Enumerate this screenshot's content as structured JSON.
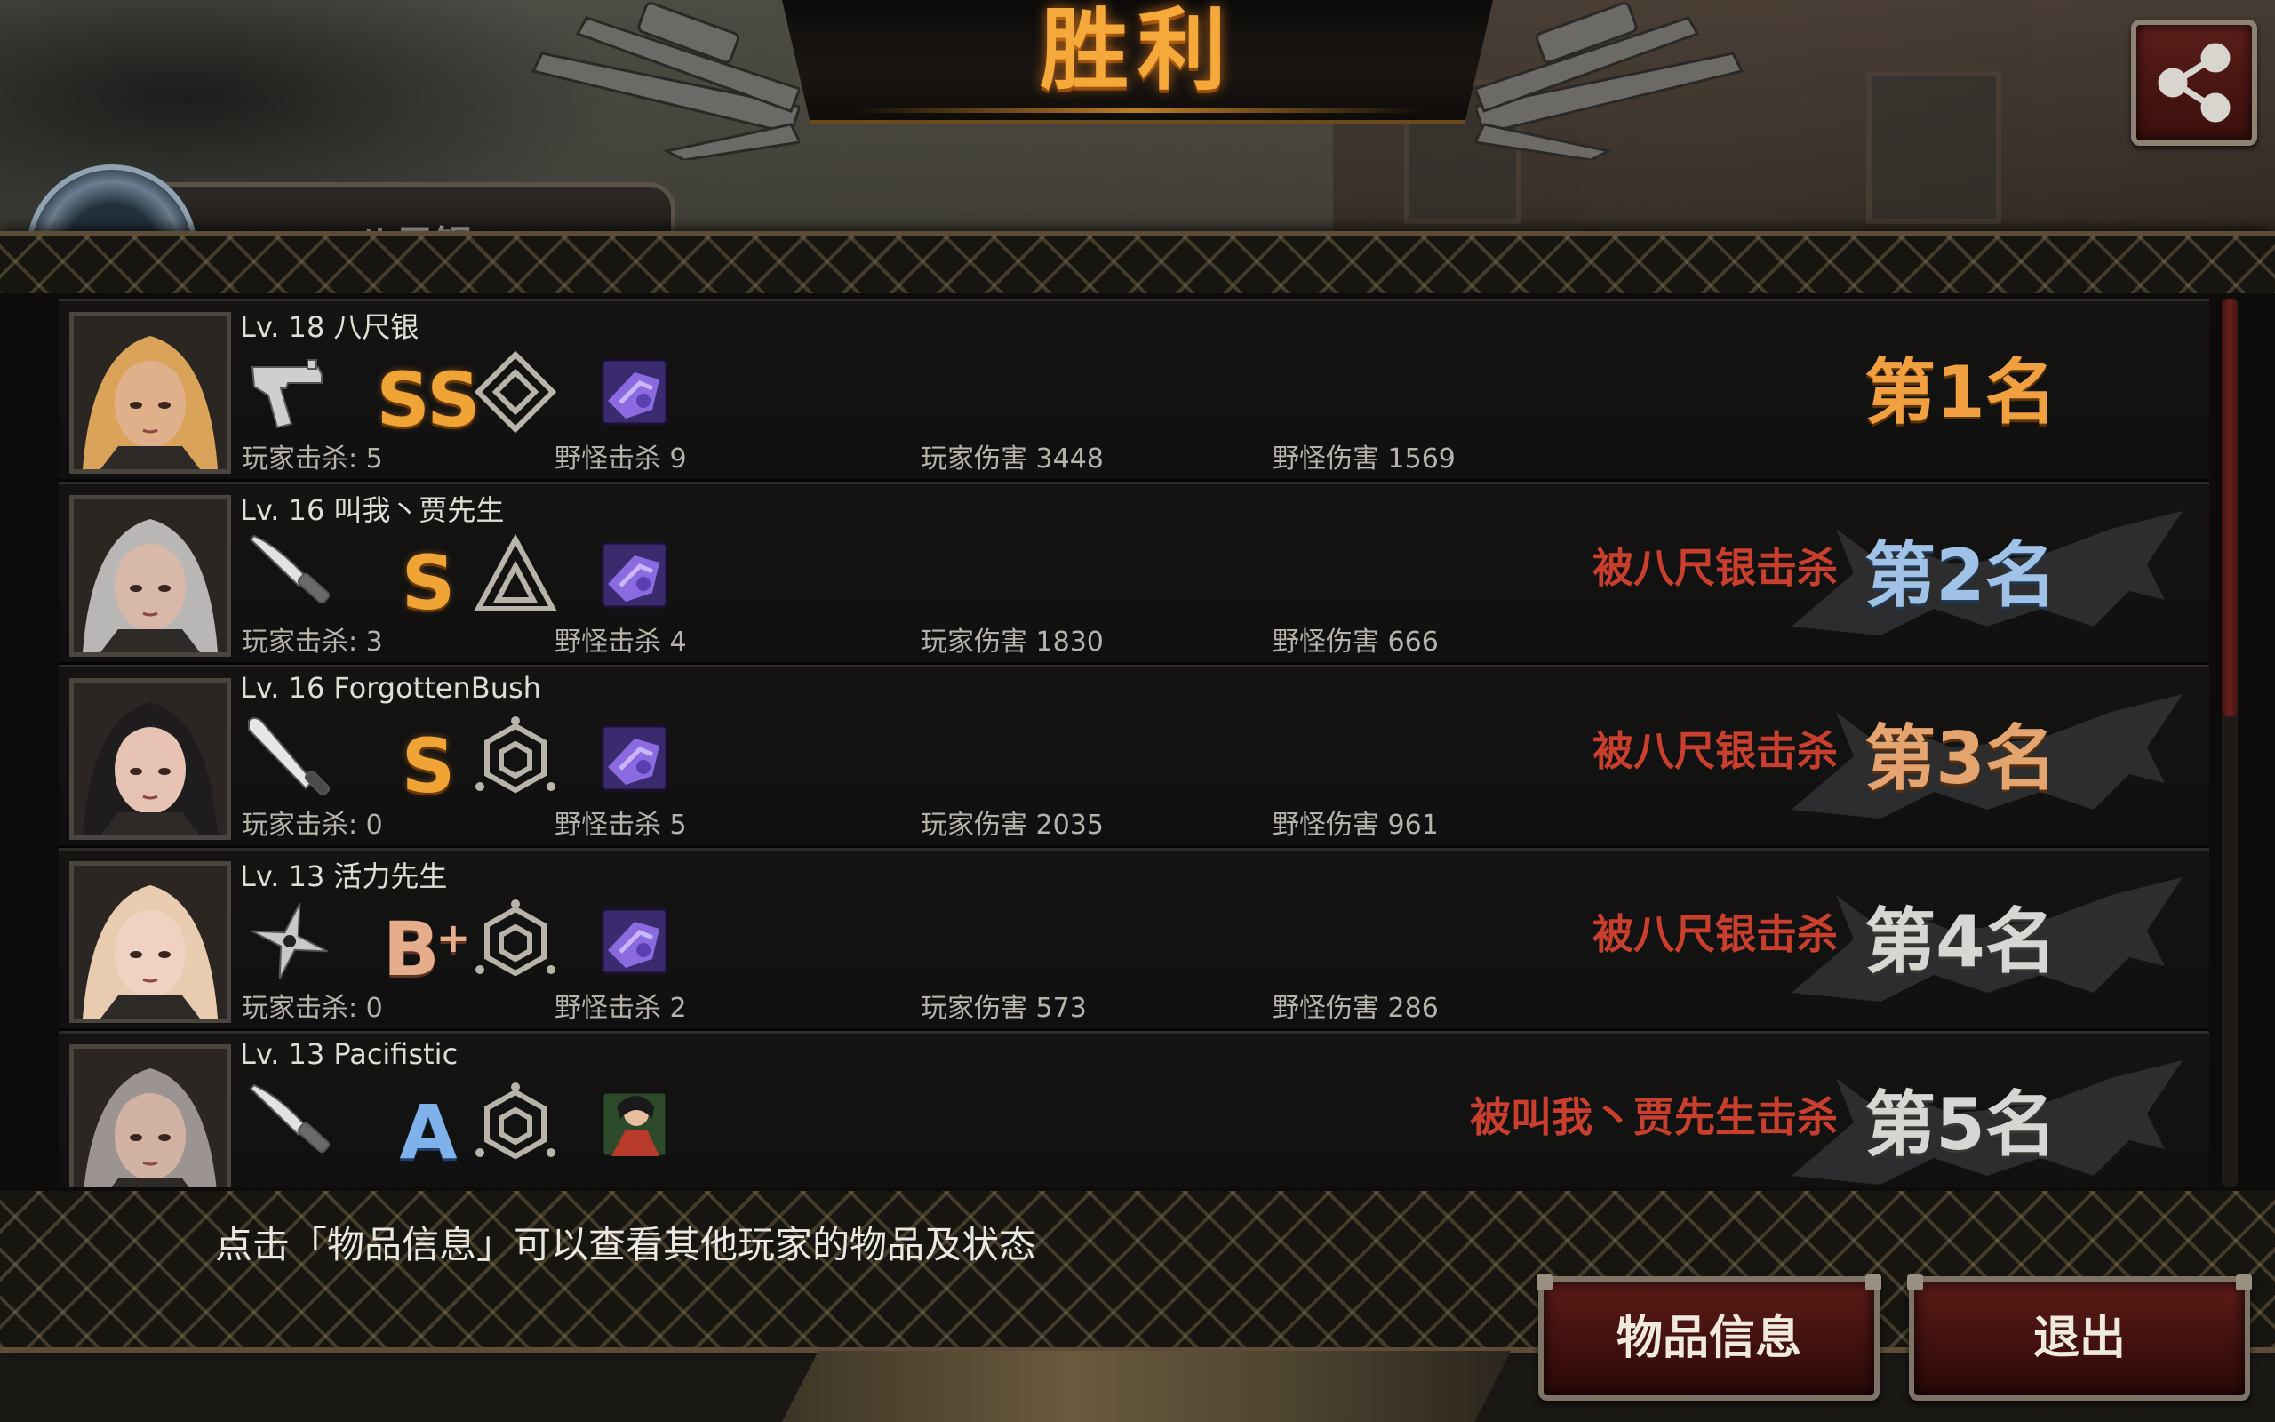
{
  "title": "胜利",
  "share_icon": "share-icon",
  "player_tag": {
    "name": "八尺银"
  },
  "players": [
    {
      "level": "Lv. 18",
      "name": "八尺银",
      "weapon_icon": "pistol-icon",
      "grade": "SS",
      "grade_sup": "",
      "rank_icon": "diamond-emblem-icon",
      "item_icon": "purple-gear-icon",
      "player_kills": "玩家击杀: 5",
      "monster_kills": "野怪击杀 9",
      "player_damage": "玩家伤害 3448",
      "monster_damage": "野怪伤害 1569",
      "killed_by": "",
      "rank": "第1名",
      "portrait_hair": "#d9a45a",
      "portrait_skin": "#e0b08a"
    },
    {
      "level": "Lv. 16",
      "name": "叫我丶贾先生",
      "weapon_icon": "knife-icon",
      "grade": "S",
      "grade_sup": "",
      "rank_icon": "triangle-emblem-icon",
      "item_icon": "purple-gear-icon",
      "player_kills": "玩家击杀: 3",
      "monster_kills": "野怪击杀 4",
      "player_damage": "玩家伤害 1830",
      "monster_damage": "野怪伤害 666",
      "killed_by": "被八尺银击杀",
      "rank": "第2名",
      "portrait_hair": "#b9b6b6",
      "portrait_skin": "#d8b8a8"
    },
    {
      "level": "Lv. 16",
      "name": "ForgottenBush",
      "weapon_icon": "bat-icon",
      "grade": "S",
      "grade_sup": "",
      "rank_icon": "hexagon-emblem-icon",
      "item_icon": "purple-gear-icon",
      "player_kills": "玩家击杀: 0",
      "monster_kills": "野怪击杀 5",
      "player_damage": "玩家伤害 2035",
      "monster_damage": "野怪伤害 961",
      "killed_by": "被八尺银击杀",
      "rank": "第3名",
      "portrait_hair": "#1e1c1d",
      "portrait_skin": "#e6c3b3"
    },
    {
      "level": "Lv. 13",
      "name": "活力先生",
      "weapon_icon": "shuriken-icon",
      "grade": "B",
      "grade_sup": "+",
      "rank_icon": "hexagon-emblem-icon",
      "item_icon": "purple-gear-icon",
      "player_kills": "玩家击杀: 0",
      "monster_kills": "野怪击杀 2",
      "player_damage": "玩家伤害 573",
      "monster_damage": "野怪伤害 286",
      "killed_by": "被八尺银击杀",
      "rank": "第4名",
      "portrait_hair": "#e9ccb0",
      "portrait_skin": "#f1d2c2"
    },
    {
      "level": "Lv. 13",
      "name": "Pacifistic",
      "weapon_icon": "knife-icon",
      "grade": "A",
      "grade_sup": "",
      "rank_icon": "hexagon-emblem-icon",
      "item_icon": "character-card-icon",
      "player_kills": "",
      "monster_kills": "",
      "player_damage": "",
      "monster_damage": "",
      "killed_by": "被叫我丶贾先生击杀",
      "rank": "第5名",
      "portrait_hair": "#9c9492",
      "portrait_skin": "#d2b2a2"
    }
  ],
  "scroll_position": 0.0,
  "hint": "点击「物品信息」可以查看其他玩家的物品及状态",
  "buttons": {
    "items": "物品信息",
    "exit": "退出"
  },
  "colors": {
    "title": "#f5a93a",
    "killed_by": "#c93f2e",
    "button_bg": "#4a1411"
  }
}
